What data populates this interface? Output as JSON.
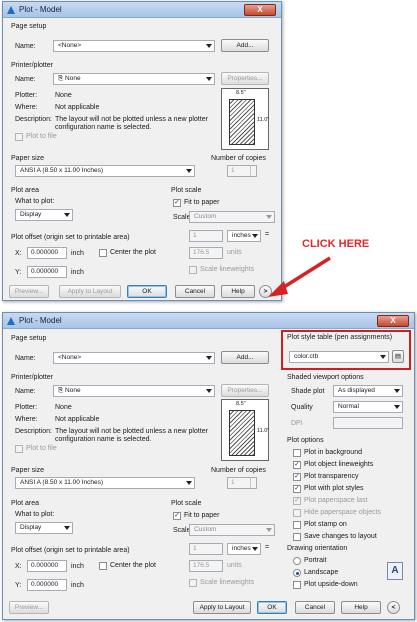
{
  "title": "Plot - Model",
  "close_glyph": "X",
  "page_setup": {
    "group": "Page setup",
    "name_label": "Name:",
    "name_value": "<None>",
    "add_button": "Add..."
  },
  "printer": {
    "group": "Printer/plotter",
    "name_label": "Name:",
    "name_value": "None",
    "properties_button": "Properties...",
    "plotter_label": "Plotter:",
    "plotter_value": "None",
    "where_label": "Where:",
    "where_value": "Not applicable",
    "description_label": "Description:",
    "description_value_1": "The layout will not be plotted unless a new plotter",
    "description_value_2": "configuration name is selected.",
    "plot_to_file": "Plot to file",
    "paper_width": "8.5\"",
    "paper_height": "11.0\""
  },
  "paper_size": {
    "group": "Paper size",
    "value": "ANSI A (8.50 x 11.00 Inches)"
  },
  "copies": {
    "group": "Number of copies",
    "value": "1"
  },
  "plot_area": {
    "group": "Plot area",
    "what_label": "What to plot:",
    "what_value": "Display"
  },
  "plot_scale": {
    "group": "Plot scale",
    "fit_to_paper": "Fit to paper",
    "scale_label": "Scale:",
    "scale_value": "Custom",
    "value1": "1",
    "units1": "inches",
    "equals": "=",
    "value2": "176.5",
    "units2": "units",
    "scale_lineweights": "Scale lineweights"
  },
  "plot_offset": {
    "group": "Plot offset (origin set to printable area)",
    "x_label": "X:",
    "x_value": "0.000000",
    "x_unit": "inch",
    "center": "Center the plot",
    "y_label": "Y:",
    "y_value": "0.000000",
    "y_unit": "inch"
  },
  "buttons": {
    "preview": "Preview...",
    "apply": "Apply to Layout",
    "ok": "OK",
    "cancel": "Cancel",
    "help": "Help",
    "expand": ">",
    "collapse": "<"
  },
  "callout": "CLICK HERE",
  "style_table": {
    "group": "Plot style table (pen assignments)",
    "value": "color.ctb"
  },
  "shaded": {
    "group": "Shaded viewport options",
    "shade_label": "Shade plot",
    "shade_value": "As displayed",
    "quality_label": "Quality",
    "quality_value": "Normal",
    "dpi_label": "DPI"
  },
  "plot_options": {
    "group": "Plot options",
    "items": [
      {
        "label": "Plot in background",
        "checked": false,
        "disabled": false
      },
      {
        "label": "Plot object lineweights",
        "checked": true,
        "disabled": false
      },
      {
        "label": "Plot transparency",
        "checked": true,
        "disabled": false
      },
      {
        "label": "Plot with plot styles",
        "checked": true,
        "disabled": false
      },
      {
        "label": "Plot paperspace last",
        "checked": true,
        "disabled": true
      },
      {
        "label": "Hide paperspace objects",
        "checked": false,
        "disabled": true
      },
      {
        "label": "Plot stamp on",
        "checked": false,
        "disabled": false
      },
      {
        "label": "Save changes to layout",
        "checked": false,
        "disabled": false
      }
    ]
  },
  "orientation": {
    "group": "Drawing orientation",
    "portrait": "Portrait",
    "landscape": "Landscape",
    "upside_down": "Plot upside-down",
    "icon": "A"
  },
  "colors": {
    "accent": "#1e6fc2",
    "callout": "#e02a2a",
    "highlight_box": "#cc2020"
  }
}
